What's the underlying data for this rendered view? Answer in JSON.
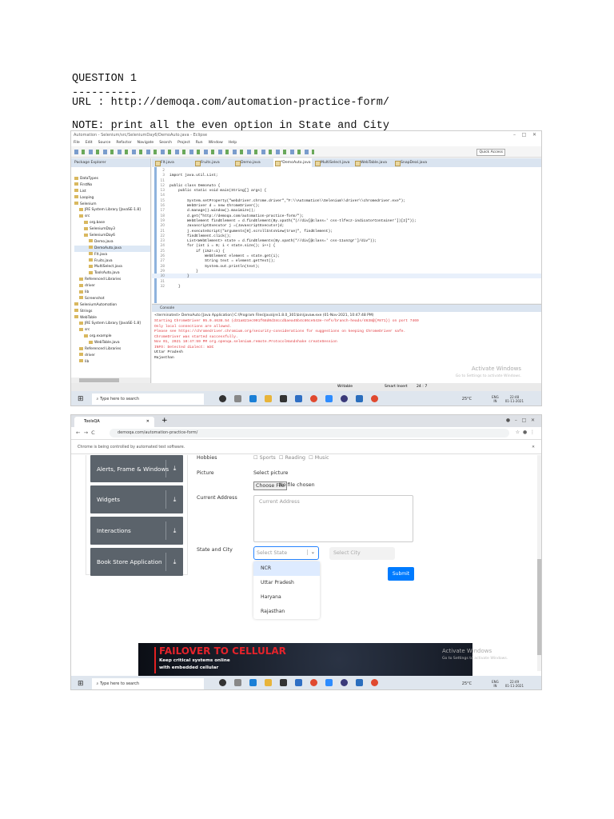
{
  "doc": {
    "heading": "QUESTION 1",
    "rule": "----------",
    "url_line": "URL : http://demoqa.com/automation-practice-form/",
    "note": "NOTE: print all the even option in State and City"
  },
  "eclipse": {
    "title": "Automation - Selenium/src/SeleniumDay6/DemoAuto.java - Eclipse",
    "menu": [
      "File",
      "Edit",
      "Source",
      "Refactor",
      "Navigate",
      "Search",
      "Project",
      "Run",
      "Window",
      "Help"
    ],
    "quick_access": "Quick Access",
    "explorer_title": "Package Explorer",
    "editor_tabs": [
      "Flt.java",
      "Fruits.java",
      "Demo.java",
      "*DemoAuto.java",
      "MultiSelect.java",
      "WebTable.java",
      "SnapDeal.java"
    ],
    "tree": [
      {
        "label": "DataTypes",
        "lvl": 0
      },
      {
        "label": "FirstNo",
        "lvl": 0
      },
      {
        "label": "List",
        "lvl": 0
      },
      {
        "label": "Looping",
        "lvl": 0
      },
      {
        "label": "Selenium",
        "lvl": 0
      },
      {
        "label": "JRE System Library [JavaSE-1.8]",
        "lvl": 1
      },
      {
        "label": "src",
        "lvl": 1
      },
      {
        "label": "org.base",
        "lvl": 2
      },
      {
        "label": "SeleniumDay3",
        "lvl": 2
      },
      {
        "label": "SeleniumDay6",
        "lvl": 2
      },
      {
        "label": "Demo.java",
        "lvl": 3
      },
      {
        "label": "DemoAuto.java",
        "lvl": 3
      },
      {
        "label": "Flt.java",
        "lvl": 3
      },
      {
        "label": "Fruits.java",
        "lvl": 3
      },
      {
        "label": "MultiSelect.java",
        "lvl": 3
      },
      {
        "label": "ToolsAuto.java",
        "lvl": 3
      },
      {
        "label": "Referenced Libraries",
        "lvl": 1
      },
      {
        "label": "driver",
        "lvl": 1
      },
      {
        "label": "lib",
        "lvl": 1
      },
      {
        "label": "Screenshot",
        "lvl": 1
      },
      {
        "label": "SeleniumAutomation",
        "lvl": 0
      },
      {
        "label": "Strings",
        "lvl": 0
      },
      {
        "label": "WebTable",
        "lvl": 0
      },
      {
        "label": "JRE System Library [JavaSE-1.8]",
        "lvl": 1
      },
      {
        "label": "src",
        "lvl": 1
      },
      {
        "label": "org.example",
        "lvl": 2
      },
      {
        "label": "WebTable.java",
        "lvl": 3
      },
      {
        "label": "Referenced Libraries",
        "lvl": 1
      },
      {
        "label": "driver",
        "lvl": 1
      },
      {
        "label": "lib",
        "lvl": 1
      }
    ],
    "code": [
      {
        "n": "2",
        "t": ""
      },
      {
        "n": "3",
        "t": "import java.util.List;"
      },
      {
        "n": "11",
        "t": ""
      },
      {
        "n": "12",
        "t": "public class DemoAuto {"
      },
      {
        "n": "13",
        "t": "    public static void main(String[] args) {"
      },
      {
        "n": "14",
        "t": ""
      },
      {
        "n": "15",
        "t": "        System.setProperty(\"webdriver.chrome.driver\",\"F:\\\\Automation\\\\Selenium\\\\driver\\\\chromedriver.exe\");"
      },
      {
        "n": "16",
        "t": "        WebDriver d = new ChromeDriver();"
      },
      {
        "n": "17",
        "t": "        d.manage().window().maximize();"
      },
      {
        "n": "18",
        "t": "        d.get(\"http://demoqa.com/automation-practice-form/\");"
      },
      {
        "n": "19",
        "t": "        WebElement findElement = d.findElement(By.xpath(\"(//div[@class=' css-tlfecz-indicatorContainer'])[2]\"));"
      },
      {
        "n": "20",
        "t": "        JavascriptExecutor j =(JavascriptExecutor)d;"
      },
      {
        "n": "21",
        "t": "        j.executeScript(\"arguments[0].scrollIntoView(true)\", findElement);"
      },
      {
        "n": "22",
        "t": "        findElement.click();"
      },
      {
        "n": "23",
        "t": "        List<WebElement> state = d.findElements(By.xpath(\"//div[@class=' css-11unzgr']/div\"));"
      },
      {
        "n": "24",
        "t": "        for (int i = 0; i < state.size(); i++) {"
      },
      {
        "n": "25",
        "t": "            if (i%2!=1) {"
      },
      {
        "n": "26",
        "t": "                WebElement element = state.get(i);"
      },
      {
        "n": "27",
        "t": "                String text = element.getText();"
      },
      {
        "n": "28",
        "t": "                System.out.println(text);"
      },
      {
        "n": "29",
        "t": "            }"
      },
      {
        "n": "30",
        "t": "        }"
      },
      {
        "n": "31",
        "t": ""
      },
      {
        "n": "32",
        "t": "    }"
      }
    ],
    "console_title": "Console",
    "console_header": "<terminated> DemoAuto [Java Application] C:\\Program Files\\Java\\jre1.8.0_301\\bin\\javaw.exe (01-Nov-2021, 10:47:48 PM)",
    "console": [
      {
        "t": "Starting ChromeDriver 95.0.4638.54 (d31a821ec901f68d0d34ccdbaea45b4c86ce543e-refs/branch-heads/4638@{#871}) on port 7469",
        "err": true
      },
      {
        "t": "Only local connections are allowed.",
        "err": true
      },
      {
        "t": "Please see https://chromedriver.chromium.org/security-considerations for suggestions on keeping ChromeDriver safe.",
        "err": true
      },
      {
        "t": "ChromeDriver was started successfully.",
        "err": true
      },
      {
        "t": "Nov 01, 2021 10:47:59 PM org.openqa.selenium.remote.ProtocolHandshake createSession",
        "err": true
      },
      {
        "t": "INFO: Detected dialect: W3C",
        "err": true
      },
      {
        "t": "Uttar Pradesh",
        "err": false
      },
      {
        "t": "Rajasthan",
        "err": false
      }
    ],
    "status": {
      "mode": "Writable",
      "insert": "Smart Insert",
      "pos": "24 : 7"
    },
    "watermark": {
      "title": "Activate Windows",
      "sub": "Go to Settings to activate Windows."
    }
  },
  "taskbar": {
    "search": "Type here to search",
    "temp": "25°C",
    "lang": "ENG",
    "region": "IN",
    "time": "22:48",
    "date": "01-11-2021"
  },
  "browser": {
    "tab_title": "ToolsQA",
    "address": "demoqa.com/automation-practice-form/",
    "infobar": "Chrome is being controlled by automated test software.",
    "sidebar": [
      "Alerts, Frame & Windows",
      "Widgets",
      "Interactions",
      "Book Store Application"
    ],
    "form": {
      "hobbies_label": "Hobbies",
      "hobbies": [
        "Sports",
        "Reading",
        "Music"
      ],
      "picture_label": "Picture",
      "select_picture": "Select picture",
      "choose_file": "Choose File",
      "no_file": "No file chosen",
      "address_label": "Current Address",
      "address_placeholder": "Current Address",
      "state_city_label": "State and City",
      "state_placeholder": "Select State",
      "city_placeholder": "Select City",
      "state_options": [
        "NCR",
        "Uttar Pradesh",
        "Haryana",
        "Rajasthan"
      ],
      "submit": "Submit"
    },
    "ad": {
      "headline": "FAILOVER TO CELLULAR",
      "line1": "Keep critical systems online",
      "line2": "with embedded cellular"
    },
    "watermark": {
      "title": "Activate Windows",
      "sub": "Go to Settings to activate Windows."
    },
    "taskbar_time": "22:49"
  }
}
